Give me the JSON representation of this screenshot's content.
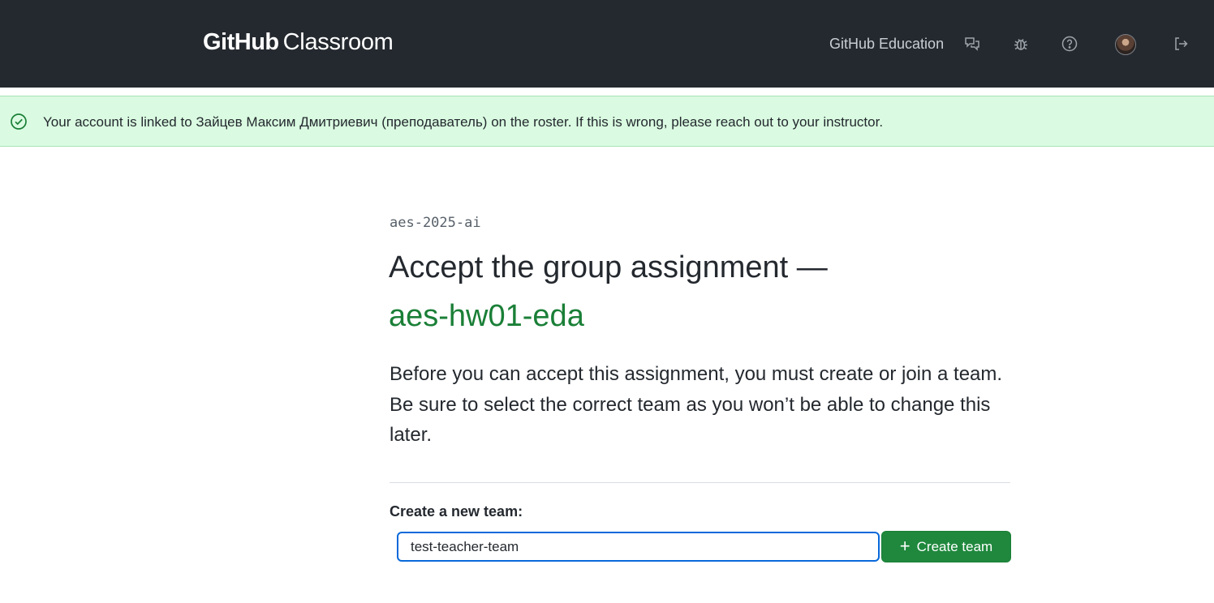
{
  "header": {
    "brand_bold": "GitHub",
    "brand_light": "Classroom",
    "nav_link": "GitHub Education",
    "icons": [
      "feedback-icon",
      "bug-icon",
      "help-icon",
      "avatar",
      "sign-out-icon"
    ]
  },
  "flash": {
    "icon": "check-circle-icon",
    "message": "Your account is linked to Зайцев Максим Дмитриевич (преподаватель) on the roster. If this is wrong, please reach out to your instructor."
  },
  "main": {
    "organization": "aes-2025-ai",
    "title_prefix": "Accept the group assignment —",
    "assignment_name": "aes-hw01-eda",
    "description": "Before you can accept this assignment, you must create or join a team. Be sure to select the correct team as you won’t be able to change this later."
  },
  "form": {
    "label": "Create a new team:",
    "input_value": "test-teacher-team",
    "button_label": "Create team",
    "button_icon": "plus-icon"
  },
  "colors": {
    "header_bg": "#24292f",
    "flash_bg": "#dafbe1",
    "accent_green": "#1a7f37",
    "button_green": "#1f883d",
    "focus_blue": "#0969da"
  }
}
